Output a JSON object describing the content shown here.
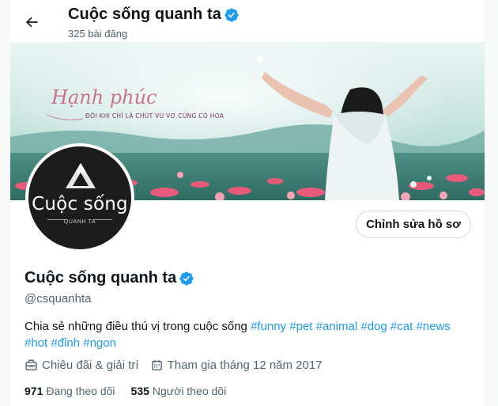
{
  "header": {
    "title": "Cuộc sống quanh ta",
    "post_count": "325 bài đăng"
  },
  "banner": {
    "overlay_script": "Hạnh phúc",
    "overlay_caption": "ĐÔI KHI CHỈ LÀ CHÚT VU VƠ CÙNG CỎ HOA"
  },
  "avatar": {
    "logo_text": "Cuộc sống",
    "logo_subtext": "QUANH TA"
  },
  "profile": {
    "edit_label": "Chỉnh sửa hồ sơ",
    "name": "Cuộc sống quanh ta",
    "handle": "@csquanhta",
    "bio_text": "Chia sẻ những điều thú vị trong cuộc sống",
    "hashtags": [
      "#funny",
      "#pet",
      "#animal",
      "#dog",
      "#cat",
      "#news",
      "#hot",
      "#đỉnh",
      "#ngon"
    ],
    "category": "Chiêu đãi & giải trí",
    "joined": "Tham gia tháng 12 năm 2017",
    "following_count": "971",
    "following_label": "Đang theo dõi",
    "followers_count": "535",
    "followers_label": "Người theo dõi"
  },
  "colors": {
    "accent": "#1d9bf0",
    "text_primary": "#0f1419",
    "text_secondary": "#536471",
    "border": "#cfd9de"
  },
  "icons": [
    "back-arrow-icon",
    "verified-badge-icon",
    "briefcase-icon",
    "calendar-icon"
  ]
}
